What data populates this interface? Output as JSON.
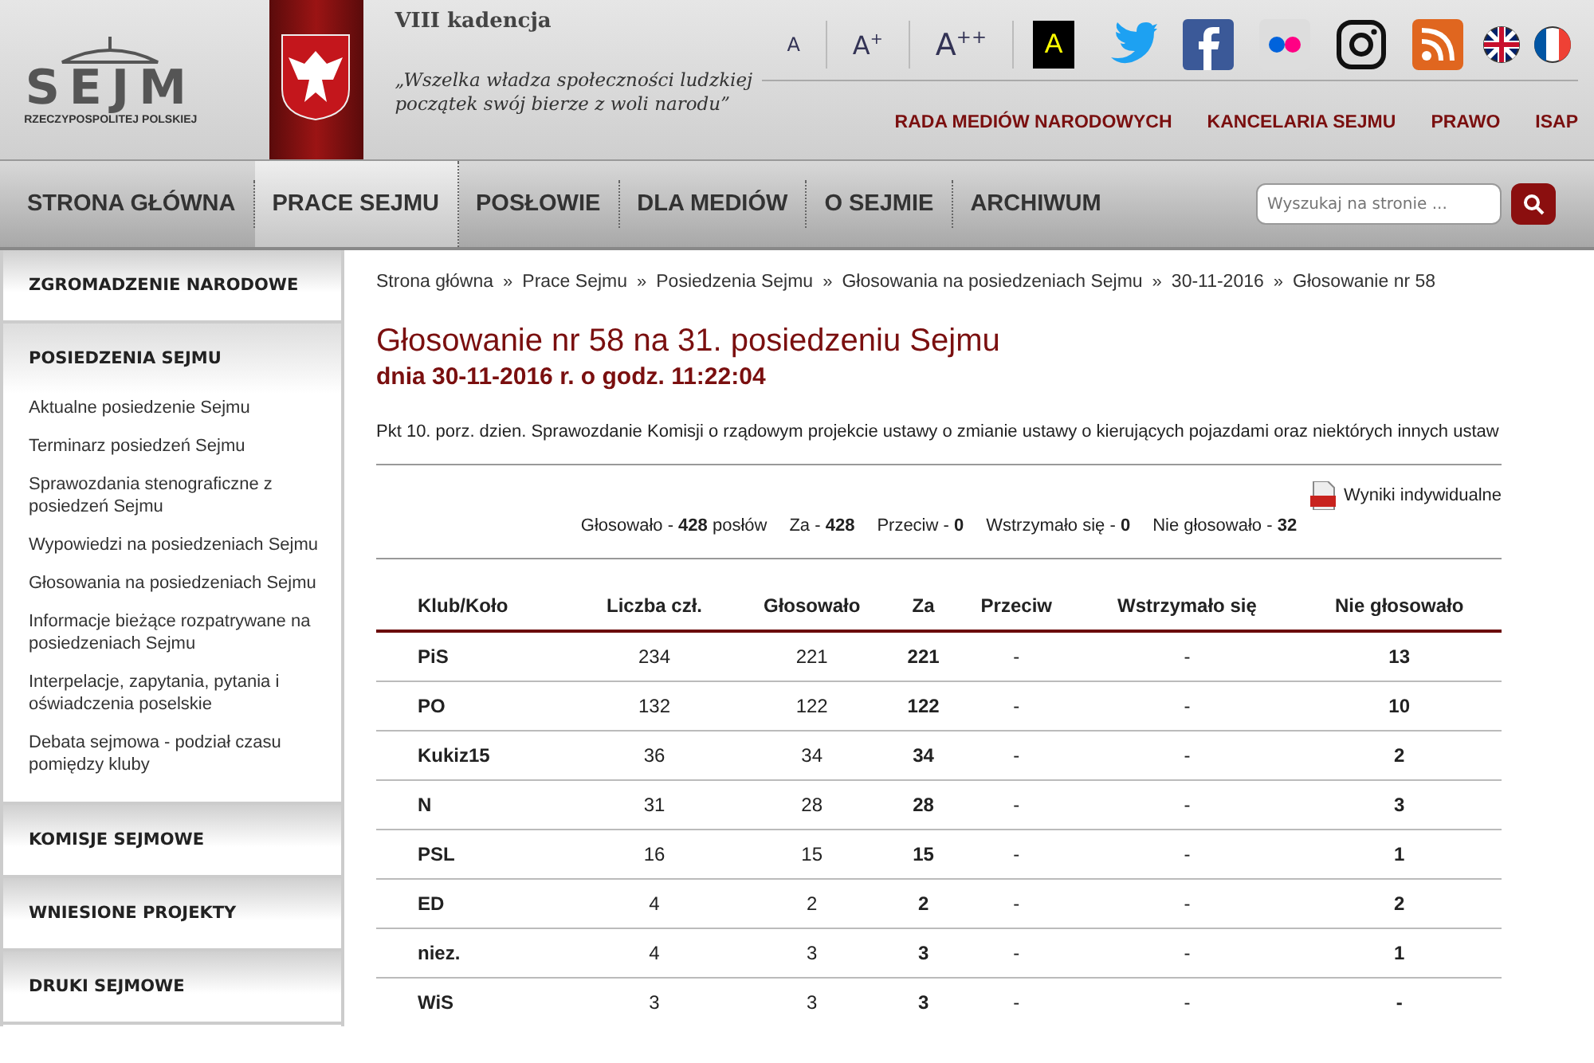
{
  "header": {
    "logo": {
      "text": "SEJM",
      "subtitle": "RZECZYPOSPOLITEJ POLSKIEJ"
    },
    "term": "VIII kadencja",
    "motto": "„Wszelka władza społeczności ludzkiej początek swój bierze z woli narodu”",
    "font_sizes": [
      "A",
      "A$^{+}$",
      "A$^{++}$"
    ],
    "contrast": "A",
    "social": [
      {
        "kind": "twitter"
      },
      {
        "kind": "facebook"
      },
      {
        "kind": "flickr"
      },
      {
        "kind": "instagram"
      },
      {
        "kind": "rss"
      }
    ],
    "languages": [
      {
        "kind": "en"
      },
      {
        "kind": "fr"
      }
    ],
    "links": [
      "RADA MEDIÓW NARODOWYCH",
      "KANCELARIA SEJMU",
      "PRAWO",
      "ISAP"
    ]
  },
  "nav": {
    "items": [
      {
        "label": "STRONA GŁÓWNA",
        "selected": false
      },
      {
        "label": "PRACE SEJMU",
        "selected": true
      },
      {
        "label": "POSŁOWIE",
        "selected": false
      },
      {
        "label": "DLA MEDIÓW",
        "selected": false
      },
      {
        "label": "O SEJMIE",
        "selected": false
      },
      {
        "label": "ARCHIWUM",
        "selected": false
      }
    ],
    "search": {
      "placeholder": "Wyszukaj na stronie ..."
    }
  },
  "sidebar": {
    "sections": [
      {
        "title": "ZGROMADZENIE NARODOWE",
        "expanded": false
      },
      {
        "title": "POSIEDZENIA SEJMU",
        "expanded": true,
        "children": [
          "Aktualne posiedzenie Sejmu",
          "Terminarz posiedzeń Sejmu",
          "Sprawozdania stenograficzne z posiedzeń Sejmu",
          "Wypowiedzi na posiedzeniach Sejmu",
          "Głosowania na posiedzeniach Sejmu",
          "Informacje bieżące rozpatrywane na posiedzeniach Sejmu",
          "Interpelacje, zapytania, pytania i oświadczenia poselskie",
          "Debata sejmowa - podział czasu pomiędzy kluby"
        ]
      },
      {
        "title": "KOMISJE SEJMOWE",
        "expanded": false
      },
      {
        "title": "WNIESIONE PROJEKTY",
        "expanded": false
      },
      {
        "title": "DRUKI SEJMOWE",
        "expanded": false
      }
    ]
  },
  "breadcrumbs": [
    {
      "label": "Strona główna"
    },
    {
      "separator": "»",
      "label": "Prace Sejmu"
    },
    {
      "separator": "»",
      "label": "Posiedzenia Sejmu"
    },
    {
      "separator": "»",
      "label": "Głosowania na posiedzeniach Sejmu"
    },
    {
      "separator": "»",
      "label": "30-11-2016"
    },
    {
      "separator": "»",
      "label": "Głosowanie nr 58"
    }
  ],
  "title": "Głosowanie nr 58 na 31. posiedzeniu Sejmu",
  "subtitle": "dnia 30-11-2016 r. o godz. 11:22:04",
  "topic": "Pkt 10. porz. dzien. Sprawozdanie Komisji o rządowym projekcie ustawy o zmianie ustawy o kierujących pojazdami oraz niektórych innych ustaw",
  "pdf_link": "Wyniki indywidualne",
  "summary": [
    "Głosowało - **428** posłów",
    "Za - **428**",
    "Przeciw - **0**",
    "Wstrzymało się - **0**",
    "Nie głosowało - **32**"
  ],
  "table": {
    "columns": [
      "Klub/Koło",
      "Liczba czł.",
      "Głosowało",
      "Za",
      "Przeciw",
      "Wstrzymało się",
      "Nie głosowało"
    ],
    "rows": [
      [
        "PiS",
        "234",
        "221",
        "221",
        "-",
        "-",
        "13"
      ],
      [
        "PO",
        "132",
        "122",
        "122",
        "-",
        "-",
        "10"
      ],
      [
        "Kukiz15",
        "36",
        "34",
        "34",
        "-",
        "-",
        "2"
      ],
      [
        "N",
        "31",
        "28",
        "28",
        "-",
        "-",
        "3"
      ],
      [
        "PSL",
        "16",
        "15",
        "15",
        "-",
        "-",
        "1"
      ],
      [
        "ED",
        "4",
        "2",
        "2",
        "-",
        "-",
        "2"
      ],
      [
        "niez.",
        "4",
        "3",
        "3",
        "-",
        "-",
        "1"
      ],
      [
        "WiS",
        "3",
        "3",
        "3",
        "-",
        "-",
        "-"
      ]
    ]
  }
}
